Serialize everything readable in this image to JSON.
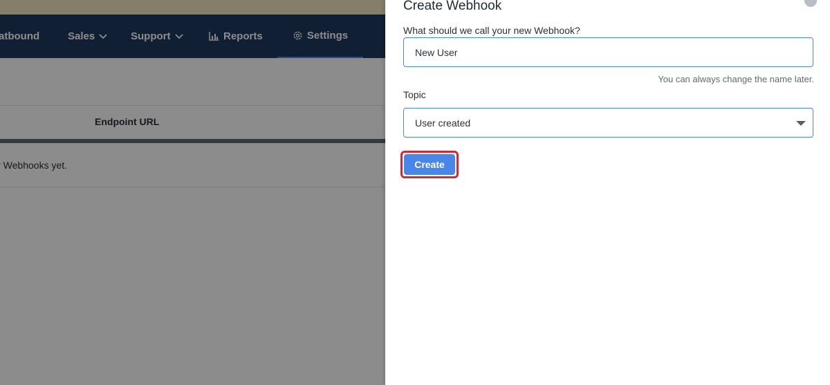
{
  "nav": {
    "items": [
      {
        "label": "atbound"
      },
      {
        "label": "Sales"
      },
      {
        "label": "Support"
      },
      {
        "label": "Reports"
      },
      {
        "label": "Settings"
      }
    ]
  },
  "table": {
    "header_endpoint": "Endpoint URL",
    "empty_text": "ny Webhooks yet."
  },
  "drawer": {
    "title": "Create Webhook",
    "name_label": "What should we call your new Webhook?",
    "name_value": "New User",
    "help_text": "You can always change the name later.",
    "topic_label": "Topic",
    "topic_value": "User created",
    "create_label": "Create"
  },
  "colors": {
    "nav_bg": "#1f3a5f",
    "accent": "#4a86e8",
    "highlight": "#d9253a",
    "banner": "#f3e6c4"
  }
}
